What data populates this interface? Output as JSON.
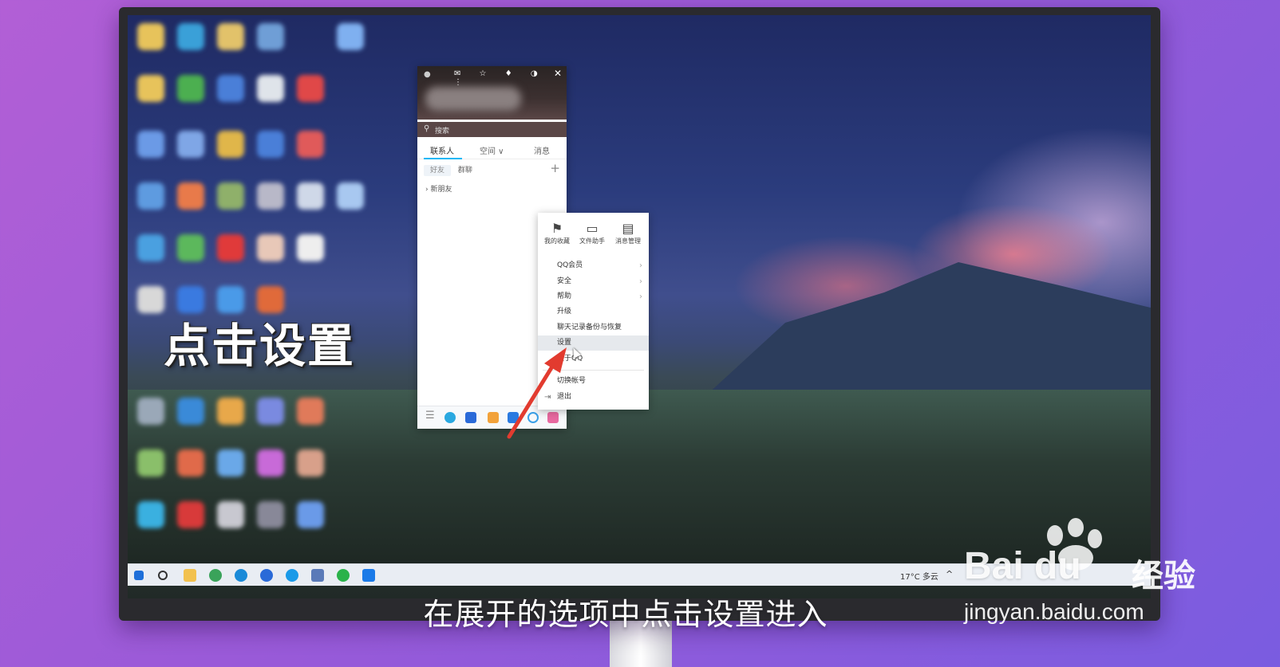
{
  "overlay_title": "点击设置",
  "subtitle": "在展开的选项中点击设置进入",
  "watermark": {
    "logo_text": "Bai du",
    "suffix": "经验",
    "url": "jingyan.baidu.com"
  },
  "qq_window": {
    "search_placeholder": "搜索",
    "tabs": [
      {
        "label": "联系人",
        "active": true
      },
      {
        "label": "空间 ∨",
        "active": false
      },
      {
        "label": "消息",
        "active": false
      }
    ],
    "sub_tabs": [
      "好友",
      "群聊"
    ],
    "new_friends": "新朋友",
    "bottom_icons": [
      "menu-icon",
      "contacts-icon",
      "tencent-docs-icon",
      "qq-pet-icon",
      "game-icon",
      "weiyun-icon",
      "app-manager-icon"
    ],
    "accent_color": "#12b7f5"
  },
  "main_menu": {
    "quick_actions": [
      {
        "label": "我的收藏",
        "icon": "bookmark-icon"
      },
      {
        "label": "文件助手",
        "icon": "folder-icon"
      },
      {
        "label": "消息管理",
        "icon": "message-manage-icon"
      }
    ],
    "items": [
      {
        "label": "QQ会员",
        "has_submenu": true
      },
      {
        "label": "安全",
        "has_submenu": true
      },
      {
        "label": "帮助",
        "has_submenu": true
      },
      {
        "label": "升级",
        "has_submenu": false
      },
      {
        "label": "聊天记录备份与恢复",
        "has_submenu": false
      },
      {
        "label": "设置",
        "has_submenu": false,
        "highlighted": true
      },
      {
        "label": "关于QQ",
        "has_submenu": false
      }
    ],
    "switch_account": "切换帐号",
    "exit": "退出"
  },
  "taskbar": {
    "weather": "17°C 多云",
    "icons": [
      "windows-start-icon",
      "cortana-icon",
      "file-explorer-icon",
      "browser-icon",
      "edge-icon",
      "qq-browser-icon",
      "app-icon",
      "screenshot-icon",
      "wechat-icon",
      "photos-icon"
    ]
  },
  "arrow_color": "#e23b2f"
}
